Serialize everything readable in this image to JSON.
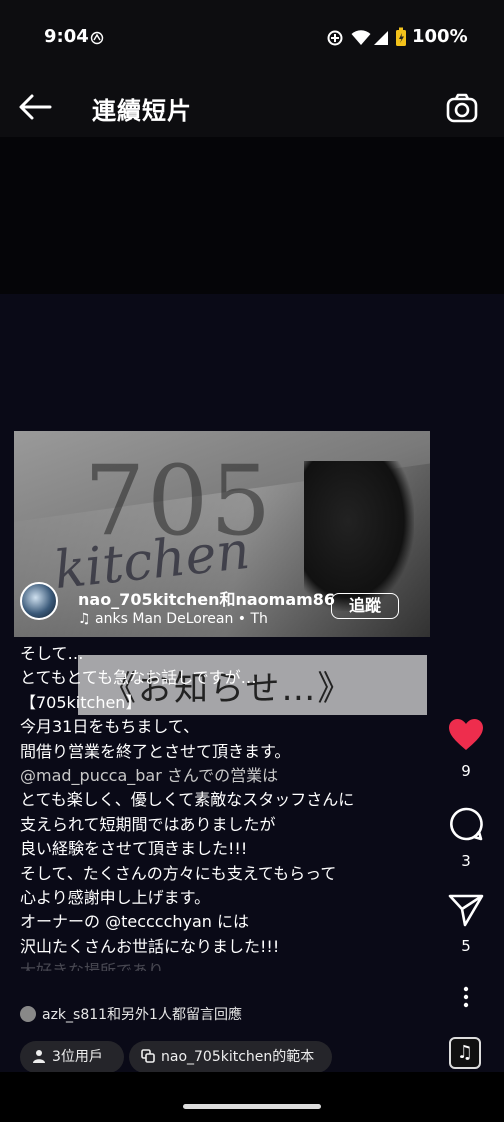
{
  "status": {
    "time": "9:04",
    "battery": "100%"
  },
  "header": {
    "title": "連續短片"
  },
  "video": {
    "thumb_number": "705",
    "thumb_script": "kitchen",
    "banner": "《お知らせ…》"
  },
  "author": {
    "names": "nao_705kitchen和naomam86",
    "music": "anks    Man DeLorean • Th",
    "follow_label": "追蹤"
  },
  "caption": {
    "lines": [
      "そして…",
      "とてもとても急なお話しですが…",
      "【705kitchen】",
      "今月31日をもちまして、",
      "間借り営業を終了とさせて頂きます。",
      "@mad_pucca_bar さんでの営業は",
      "とても楽しく、優しくて素敵なスタッフさんに",
      "支えられて短期間ではありましたが",
      "良い経験をさせて頂きました!!!",
      "そして、たくさんの方々にも支えてもらって",
      "心より感謝申し上げます。",
      "オーナーの @tecccchyan には",
      "沢山たくさんお世話になりました!!!",
      "大好きな場所であり"
    ]
  },
  "actions": {
    "likes": "9",
    "comments": "3",
    "shares": "5"
  },
  "comments_row": {
    "text": "azk_s811和另外1人都留言回應"
  },
  "chips": {
    "users": "3位用戶",
    "template": "nao_705kitchen的範本"
  },
  "colors": {
    "like": "#ee2d4d",
    "bg": "#0a0a17"
  }
}
